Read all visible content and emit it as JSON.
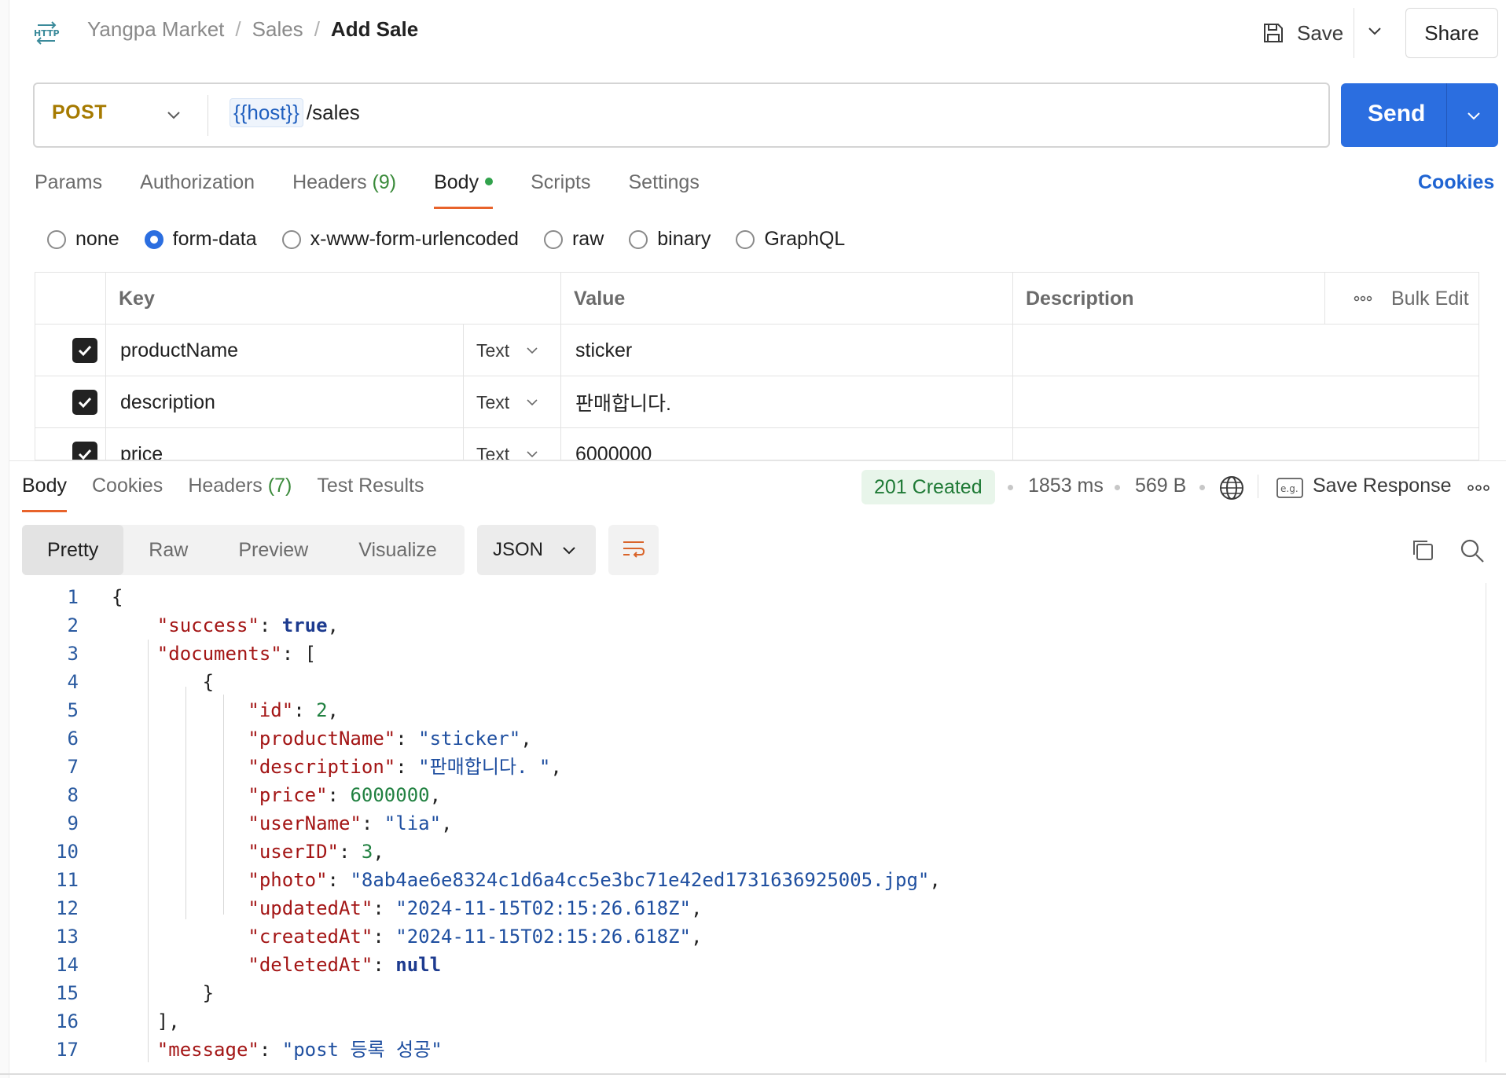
{
  "header": {
    "breadcrumb": [
      "Yangpa Market",
      "Sales"
    ],
    "current": "Add Sale",
    "save_label": "Save",
    "share_label": "Share"
  },
  "request": {
    "method": "POST",
    "url_var": "{{host}}",
    "url_path": "/sales",
    "send_label": "Send"
  },
  "tabs": [
    {
      "label": "Params"
    },
    {
      "label": "Authorization"
    },
    {
      "label": "Headers",
      "count": "(9)"
    },
    {
      "label": "Body",
      "active": true
    },
    {
      "label": "Scripts"
    },
    {
      "label": "Settings"
    }
  ],
  "cookies_label": "Cookies",
  "body_types": [
    "none",
    "form-data",
    "x-www-form-urlencoded",
    "raw",
    "binary",
    "GraphQL"
  ],
  "form_table": {
    "headers": {
      "key": "Key",
      "value": "Value",
      "description": "Description",
      "bulk_edit": "Bulk Edit"
    },
    "rows": [
      {
        "key": "productName",
        "type": "Text",
        "value": "sticker"
      },
      {
        "key": "description",
        "type": "Text",
        "value": "판매합니다."
      },
      {
        "key": "price",
        "type": "Text",
        "value": "6000000"
      }
    ]
  },
  "response": {
    "tabs": [
      {
        "label": "Body"
      },
      {
        "label": "Cookies"
      },
      {
        "label": "Headers",
        "count": "(7)"
      },
      {
        "label": "Test Results"
      }
    ],
    "status": "201 Created",
    "time": "1853 ms",
    "size": "569 B",
    "save_response": "Save Response",
    "views": [
      "Pretty",
      "Raw",
      "Preview",
      "Visualize"
    ],
    "format": "JSON",
    "line_numbers": [
      "1",
      "2",
      "3",
      "4",
      "5",
      "6",
      "7",
      "8",
      "9",
      "10",
      "11",
      "12",
      "13",
      "14",
      "15",
      "16",
      "17"
    ]
  },
  "colors": {
    "accent": "#2b6ee0",
    "method": "#a67a00",
    "status_bg": "#e8f5ea",
    "status_fg": "#1f7a36",
    "tab_underline": "#e8632b"
  },
  "icons": [
    "http-icon",
    "save-icon",
    "chevron-down-icon",
    "globe-icon",
    "example-icon",
    "more-icon",
    "wrap-icon",
    "copy-icon",
    "search-icon",
    "checkmark-icon"
  ]
}
